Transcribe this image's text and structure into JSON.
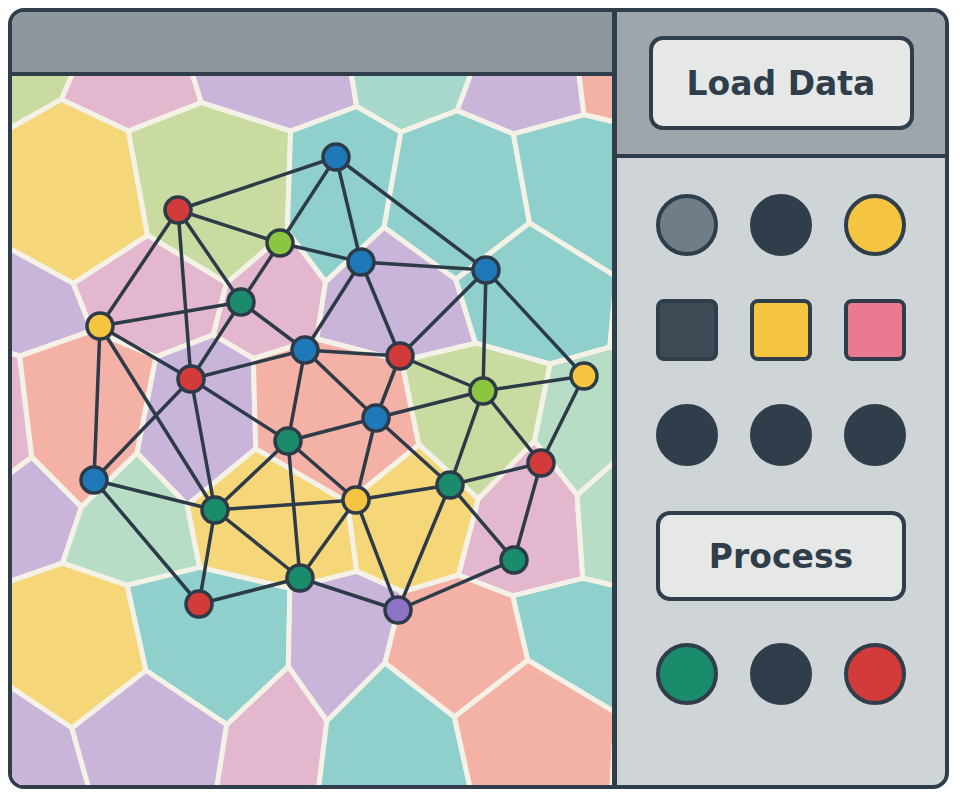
{
  "toolbar": {
    "load_button": "Load Data",
    "process_button": "Process"
  },
  "swatches": [
    {
      "kind": "circle",
      "color": "#6f7d88"
    },
    {
      "kind": "circle",
      "color": "#2f3e4a"
    },
    {
      "kind": "circle",
      "color": "#f5c542"
    },
    {
      "kind": "square",
      "color": "#3d4b57"
    },
    {
      "kind": "square",
      "color": "#f5c542"
    },
    {
      "kind": "square",
      "color": "#e97a92"
    },
    {
      "kind": "circle",
      "color": "#2f3e4a"
    },
    {
      "kind": "circle",
      "color": "#2f3e4a"
    },
    {
      "kind": "circle",
      "color": "#2f3e4a"
    }
  ],
  "process_swatches": [
    {
      "kind": "circle",
      "color": "#1a8c6c"
    },
    {
      "kind": "circle",
      "color": "#2f3e4a"
    },
    {
      "kind": "circle",
      "color": "#d33a3a"
    }
  ],
  "graph": {
    "nodes": [
      {
        "color": "#1f78b8"
      },
      {
        "color": "#d33a3a"
      },
      {
        "color": "#8cc640"
      },
      {
        "color": "#1f78b8"
      },
      {
        "color": "#1f78b8"
      },
      {
        "color": "#1a8c6c"
      },
      {
        "color": "#f5c542"
      },
      {
        "color": "#1f78b8"
      },
      {
        "color": "#d33a3a"
      },
      {
        "color": "#d33a3a"
      },
      {
        "color": "#8cc640"
      },
      {
        "color": "#f5c542"
      },
      {
        "color": "#1f78b8"
      },
      {
        "color": "#1a8c6c"
      },
      {
        "color": "#d33a3a"
      },
      {
        "color": "#1f78b8"
      },
      {
        "color": "#1a8c6c"
      },
      {
        "color": "#f5c542"
      },
      {
        "color": "#1a8c6c"
      },
      {
        "color": "#1a8c6c"
      },
      {
        "color": "#1a8c6c"
      },
      {
        "color": "#d33a3a"
      },
      {
        "color": "#8c73c5"
      }
    ]
  }
}
